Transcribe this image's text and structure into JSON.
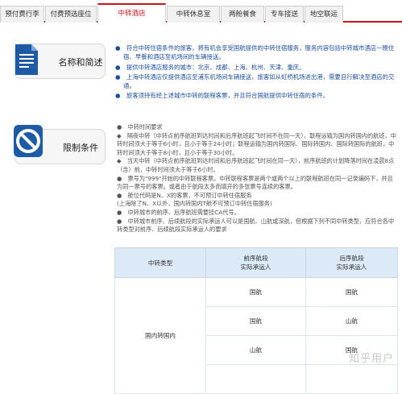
{
  "tabs": [
    {
      "label": "预付费行李"
    },
    {
      "label": "付费预选座位"
    },
    {
      "label": "中转酒店"
    },
    {
      "label": "中转休息室"
    },
    {
      "label": "两舱餐食"
    },
    {
      "label": "专车接送"
    },
    {
      "label": "地空联运"
    }
  ],
  "section1": {
    "title": "名称和简述",
    "paragraphs": [
      "●　符合中转住宿条件的旅客，将有机会享受国航提供的中转住宿服务，服务内容包括中转城市酒店一晚住宿、早餐和酒店至机场间的车辆接送。",
      "●　提供中转酒店服务的城市：北京、成都、上海、杭州、天津、重庆。",
      "●　上海中转酒店仅提供酒店至浦东机场间车辆接送，旅客如从虹桥机场进出港，需要自行解决至酒店的交通。",
      "●　旅客须持有经上述城市中转的联程客票，并且符合国航提供中转住宿的条件。"
    ]
  },
  "section2": {
    "title": "限制条件",
    "paragraphs": [
      "●　中转时间要求",
      "◆　隔夜中转（中转点前序航班到达时间和后序航班起飞时间不在同一天），联程运输为国内转国内的航班，中转时间须大于等于6小时，且小于等于24小时；联程运输为国内转国际、国际转国内、国际转国际的航班，中转时间须大于等于8小时，且小于等于30小时。",
      "◆　当天中转（中转点前序航班到达时间和后序航班起飞时间在同一天），前序航班的计划降落时间在凌晨8点（含）前，中转时间须大于等于6小时。",
      "●　票号为\"999\"开始的中转联程客票。中转联程客票是两个或两个以上的联程航班在同一记录编码下，并且为同一票号的客票。或者由于航段太多而填开的多张票号连续的客票。",
      "●　舱位代码是N、X的客票，不可预订中转住宿服务",
      "(上海除了N、X以外，国内转国内T舱不可预订中转住宿服务)",
      "●　中转城市的前序、后序航班需要挂CA代号。",
      "●　中转城市前序、后续航段的实际承运人可以是国航、山航或深航，但根据下列不同中转类型，应符合各中转类型对前序、后续航段实际承运人的要求"
    ]
  },
  "table": {
    "headers": [
      "中转类型",
      "前序航段\n实际承运人",
      "后序航段\n实际承运人"
    ],
    "type_label": "国内转国内",
    "rows": [
      [
        "国航",
        "国航"
      ],
      [
        "国航",
        "山航"
      ],
      [
        "山航",
        "国航"
      ],
      [
        "",
        ""
      ]
    ]
  },
  "watermark": "知乎用户",
  "colors": {
    "accent": "#c8161d",
    "blue_text": "#1a4f9c",
    "table_header": "#dce9f7"
  }
}
